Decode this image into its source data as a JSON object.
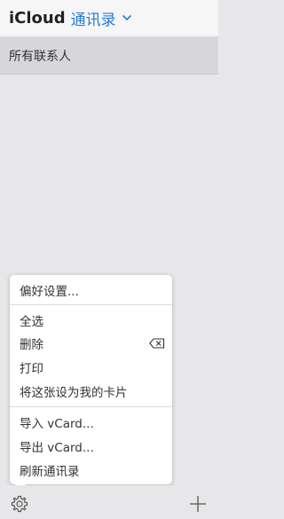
{
  "header": {
    "brand": "iCloud",
    "app_title": "通讯录"
  },
  "groups": {
    "selected": "所有联系人"
  },
  "menu": {
    "items": [
      {
        "label": "偏好设置..."
      },
      {
        "label": "全选"
      },
      {
        "label": "删除",
        "icon": "delete-backspace-icon"
      },
      {
        "label": "打印"
      },
      {
        "label": "将这张设为我的卡片"
      },
      {
        "label": "导入 vCard..."
      },
      {
        "label": "导出 vCard..."
      },
      {
        "label": "刷新通讯录"
      }
    ]
  },
  "footer": {
    "left_icon": "gear-icon",
    "right_icon": "plus-icon"
  },
  "colors": {
    "accent": "#2a7bd6",
    "background": "#e7e7e9",
    "selected_row": "#d7d7db"
  }
}
